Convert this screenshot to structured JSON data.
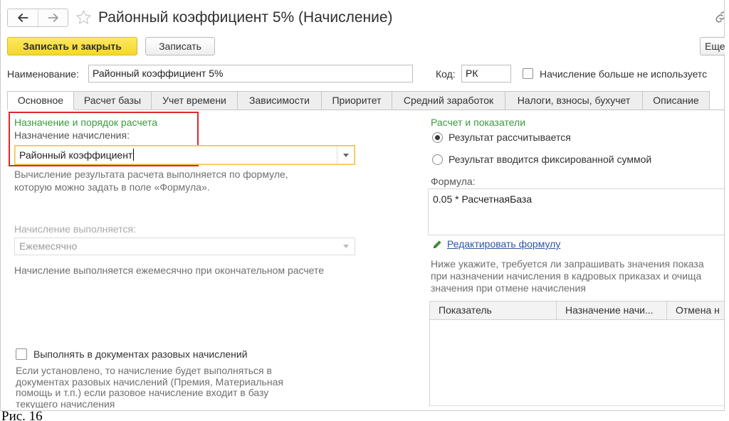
{
  "colors": {
    "accent_yellow": "#f6d62f",
    "section_green": "#3d9a3d",
    "link_blue": "#2d55a3",
    "highlight_red": "#e0262b",
    "focus_border": "#eec048"
  },
  "header": {
    "back_icon": "arrow-left-icon",
    "forward_icon": "arrow-right-icon",
    "favorite_icon": "star-icon",
    "title": "Районный коэффициент 5% (Начисление)",
    "link_icon": "chain-link-icon"
  },
  "toolbar": {
    "save_close_label": "Записать и закрыть",
    "save_label": "Записать",
    "more_label": "Еще"
  },
  "fields": {
    "name_label": "Наименование:",
    "name_value": "Районный коэффициент 5%",
    "code_label": "Код:",
    "code_value": "РК",
    "not_used_label": "Начисление больше не используетс",
    "not_used_checked": false
  },
  "tabs": [
    {
      "label": "Основное",
      "active": true
    },
    {
      "label": "Расчет базы",
      "active": false
    },
    {
      "label": "Учет времени",
      "active": false
    },
    {
      "label": "Зависимости",
      "active": false
    },
    {
      "label": "Приоритет",
      "active": false
    },
    {
      "label": "Средний заработок",
      "active": false
    },
    {
      "label": "Налоги, взносы, бухучет",
      "active": false
    },
    {
      "label": "Описание",
      "active": false
    }
  ],
  "left_panel": {
    "section_title": "Назначение и порядок расчета",
    "purpose_label": "Назначение начисления:",
    "purpose_value": "Районный коэффициент",
    "purpose_hint": [
      "Вычисление результата расчета выполняется по формуле,",
      "которую можно задать в поле «Формула»."
    ],
    "schedule_label": "Начисление выполняется:",
    "schedule_value": "Ежемесячно",
    "schedule_hint": "Начисление выполняется ежемесячно при окончательном расчете",
    "one_time_label": "Выполнять в документах разовых начислений",
    "one_time_checked": false,
    "one_time_hint": [
      "Если установлено, то начисление будет выполняться в",
      "документах разовых начислений (Премия, Материальная",
      "помощь и т.п.) если разовое начисление входит в базу",
      "текущего начисления"
    ]
  },
  "right_panel": {
    "section_title": "Расчет и показатели",
    "mode_options": [
      {
        "label": "Результат рассчитывается",
        "selected": true
      },
      {
        "label": "Результат вводится фиксированной суммой",
        "selected": false
      }
    ],
    "formula_label": "Формула:",
    "formula_value": "0.05 * РасчетнаяБаза",
    "edit_formula_icon": "pencil-icon",
    "edit_formula_link": "Редактировать формулу",
    "indicators_hint": [
      "Ниже укажите, требуется ли запрашивать значения показа",
      "при назначении начисления в кадровых приказах и очища",
      "значения при отмене начисления"
    ],
    "table_columns": [
      "Показатель",
      "Назначение начи...",
      "Отмена н"
    ]
  },
  "caption": "Рис. 16"
}
